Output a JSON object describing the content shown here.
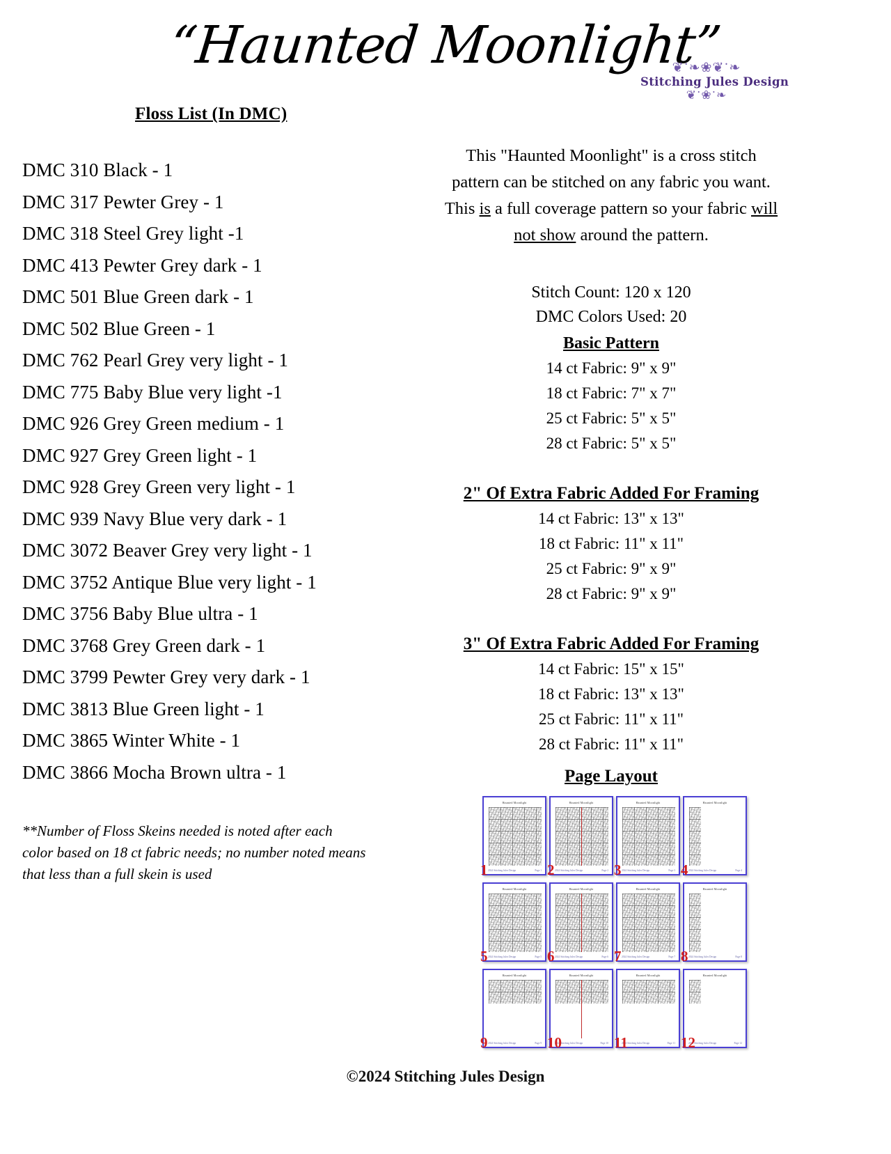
{
  "header": {
    "title": "“Haunted Moonlight”",
    "logo": {
      "name": "Stitching Jules Design",
      "flourish_top": "❦ॱ❧❀❦ॱ❧",
      "flourish_bottom": "❦ॱ❀ॱ❧",
      "color": "#5b3f96"
    }
  },
  "floss": {
    "heading": "Floss List (In DMC)",
    "items": [
      "DMC 310 Black - 1",
      "DMC 317 Pewter Grey - 1",
      "DMC 318 Steel Grey light -1",
      "DMC 413 Pewter Grey dark - 1",
      "DMC 501 Blue Green dark - 1",
      "DMC 502 Blue Green - 1",
      "DMC 762 Pearl Grey very light - 1",
      "DMC 775 Baby Blue very light -1",
      "DMC 926 Grey Green medium - 1",
      "DMC 927 Grey Green light - 1",
      "DMC 928 Grey Green very light - 1",
      "DMC 939 Navy Blue very dark - 1",
      "DMC 3072 Beaver Grey very light - 1",
      "DMC 3752 Antique Blue very light - 1",
      "DMC 3756 Baby Blue ultra - 1",
      "DMC 3768 Grey Green dark - 1",
      "DMC 3799 Pewter Grey very dark - 1",
      "DMC 3813 Blue Green light - 1",
      "DMC 3865 Winter White - 1",
      "DMC 3866 Mocha Brown ultra - 1"
    ],
    "note_line1": "**Number of Floss Skeins needed is noted after each",
    "note_line2": "color based on 18 ct fabric needs; no number noted means",
    "note_line3": "that less than a full skein is used"
  },
  "intro": {
    "line1": "This \"Haunted Moonlight\" is a cross stitch",
    "line2": "pattern can be stitched on any fabric you want.",
    "line3_a": "This ",
    "line3_u1": "is",
    "line3_b": " a full coverage  pattern  so  your fabric ",
    "line3_u2": "will",
    "line4_u": "not show",
    "line4_b": " around the pattern."
  },
  "stats": {
    "stitch_count": "Stitch Count:  120 x 120",
    "colors_used": "DMC Colors Used: 20"
  },
  "basic_pattern": {
    "heading": "Basic Pattern",
    "rows": [
      "14 ct Fabric: 9\" x 9\"",
      "18 ct Fabric: 7\" x 7\"",
      "25 ct Fabric: 5\" x 5\"",
      "28 ct Fabric:  5\" x 5\""
    ]
  },
  "framing_2in": {
    "heading": "2\" Of Extra Fabric Added For Framing",
    "rows": [
      "14 ct Fabric:  13\" x 13\"",
      "18 ct Fabric:  11\" x 11\"",
      "25 ct Fabric:  9\" x 9\"",
      "28 ct Fabric: 9\" x 9\""
    ]
  },
  "framing_3in": {
    "heading": "3\" Of Extra Fabric Added For Framing",
    "rows": [
      "14 ct Fabric:  15\" x 15\"",
      "18 ct Fabric:  13\" x 13\"",
      "25 ct Fabric:  11\" x 11\"",
      "28 ct Fabric:  11\" x 11\""
    ]
  },
  "page_layout": {
    "heading": "Page Layout",
    "thumb_title": "Haunted Moonlight",
    "thumb_footer_left": "2024 Stitching Jules Design",
    "border_color": "#4a3fd4",
    "number_color": "#d11f1f",
    "pages": [
      {
        "num": "1",
        "kind": "full",
        "footer_right": "Page 1"
      },
      {
        "num": "2",
        "kind": "full-center",
        "footer_right": "Page 2"
      },
      {
        "num": "3",
        "kind": "full",
        "footer_right": "Page 3"
      },
      {
        "num": "4",
        "kind": "narrow",
        "footer_right": "Page 4"
      },
      {
        "num": "5",
        "kind": "full",
        "footer_right": "Page 5"
      },
      {
        "num": "6",
        "kind": "full-center",
        "footer_right": "Page 6"
      },
      {
        "num": "7",
        "kind": "full",
        "footer_right": "Page 7"
      },
      {
        "num": "8",
        "kind": "narrow",
        "footer_right": "Page 8"
      },
      {
        "num": "9",
        "kind": "short",
        "footer_right": "Page 9"
      },
      {
        "num": "10",
        "kind": "short-center",
        "footer_right": "Page 10"
      },
      {
        "num": "11",
        "kind": "short",
        "footer_right": "Page 11"
      },
      {
        "num": "12",
        "kind": "short-narrow",
        "footer_right": "Page 12"
      }
    ]
  },
  "footer": {
    "copyright": "©2024 Stitching Jules Design"
  }
}
